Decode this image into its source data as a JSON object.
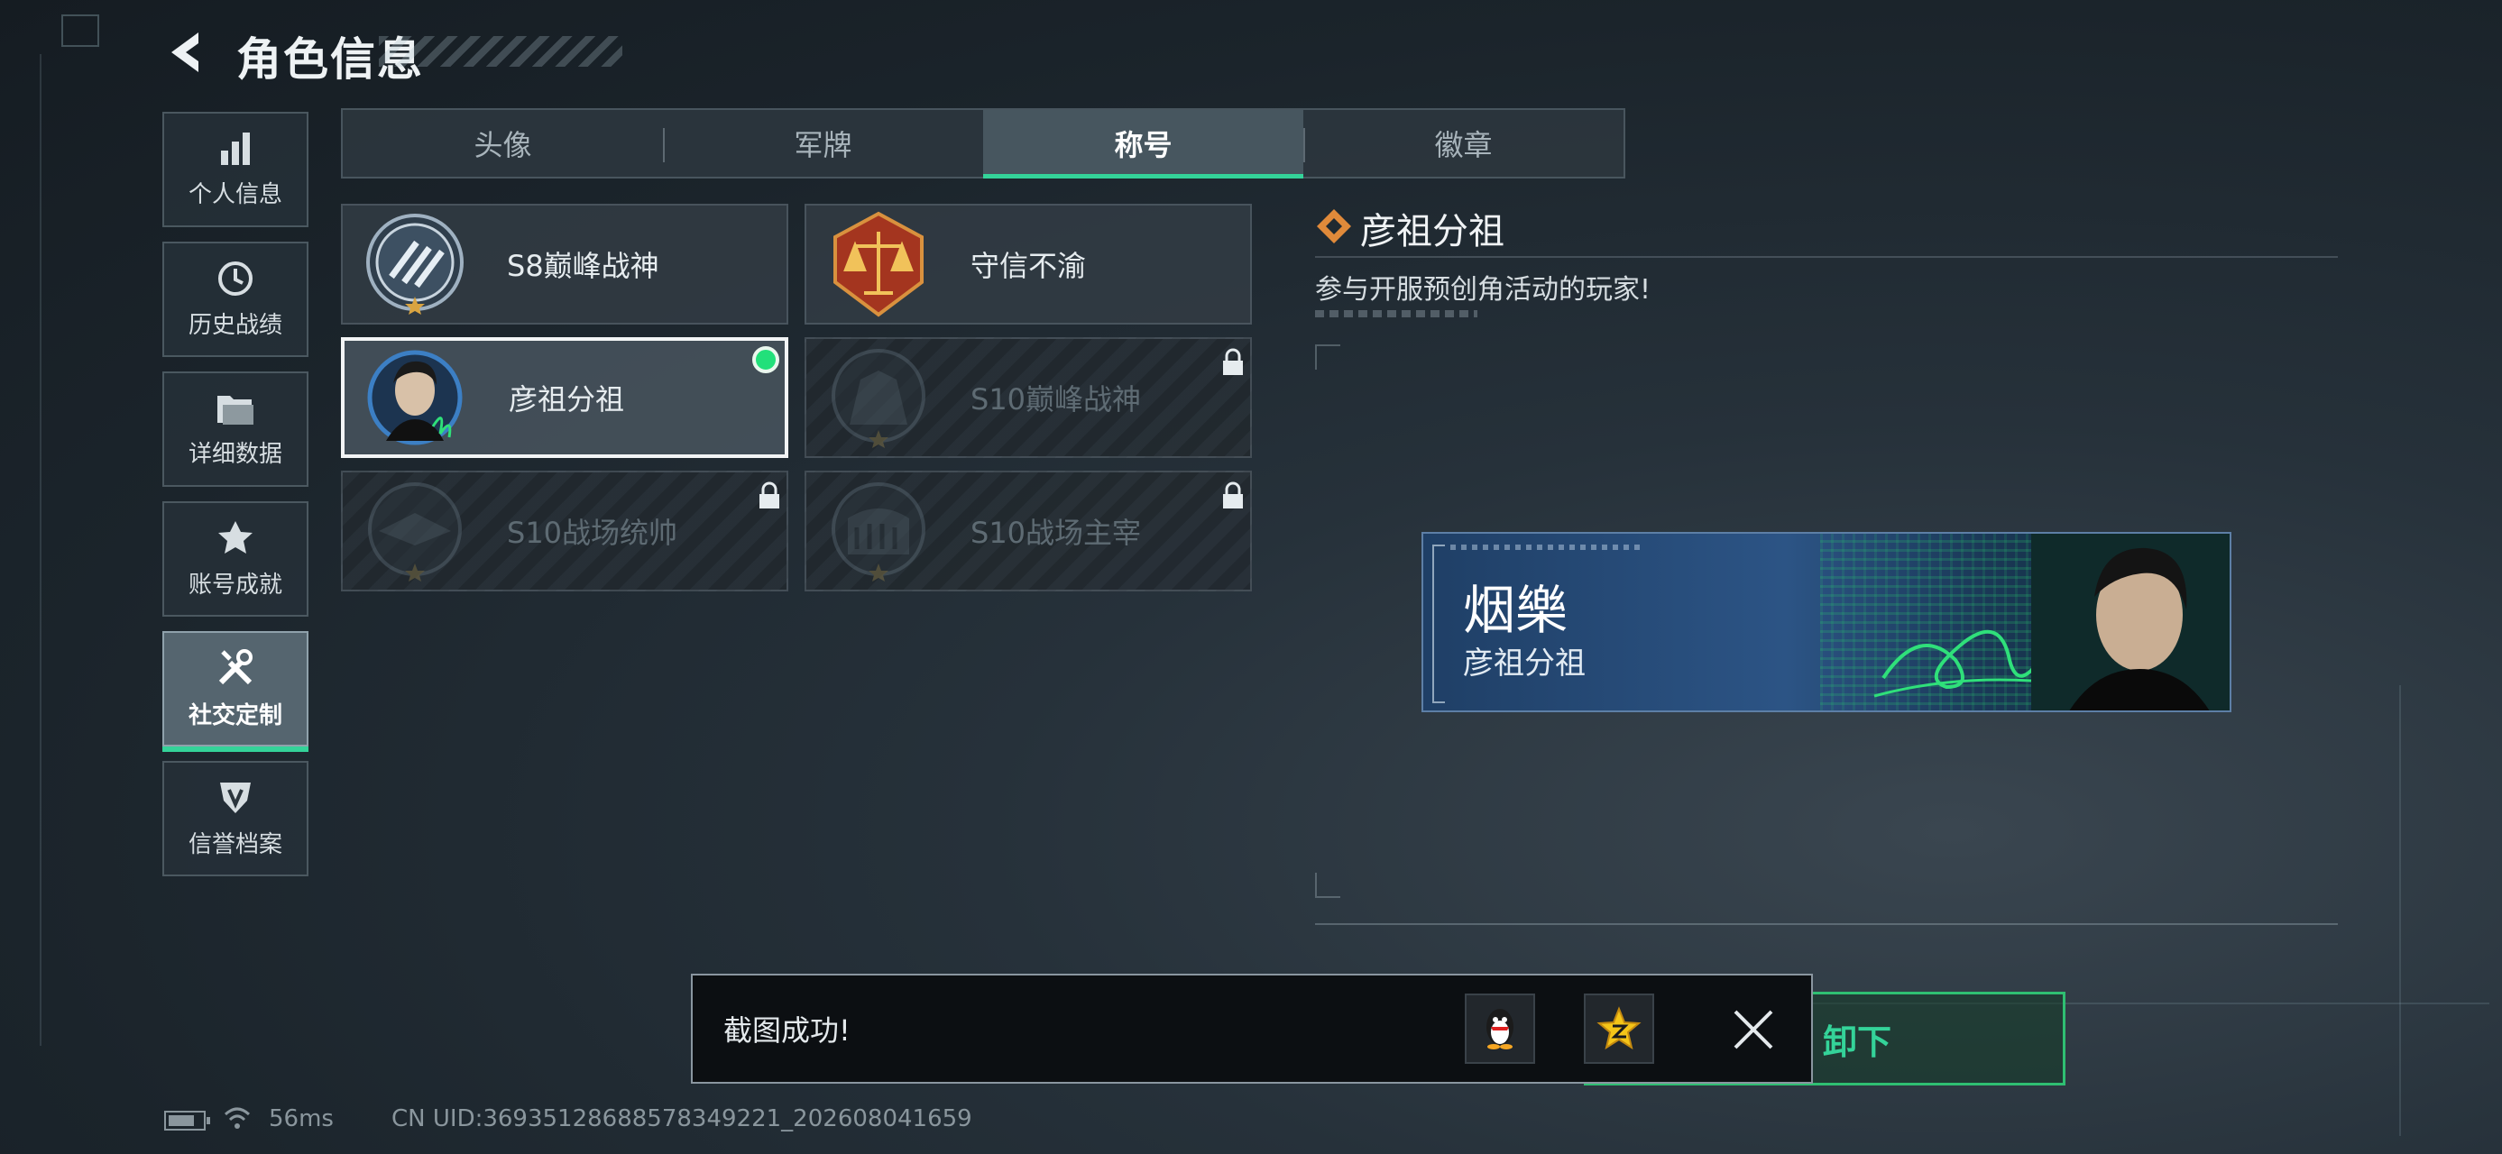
{
  "header": {
    "title": "角色信息"
  },
  "sidebar": {
    "items": [
      {
        "label": "个人信息",
        "icon": "bar-chart-icon"
      },
      {
        "label": "历史战绩",
        "icon": "history-clock-icon"
      },
      {
        "label": "详细数据",
        "icon": "folder-icon"
      },
      {
        "label": "账号成就",
        "icon": "achievement-icon"
      },
      {
        "label": "社交定制",
        "icon": "tools-icon",
        "active": true
      },
      {
        "label": "信誉档案",
        "icon": "shield-badge-icon"
      }
    ]
  },
  "tabs": [
    {
      "label": "头像"
    },
    {
      "label": "军牌"
    },
    {
      "label": "称号",
      "active": true
    },
    {
      "label": "徽章"
    }
  ],
  "titles": [
    {
      "name": "S8巅峰战神",
      "locked": false,
      "selected": false
    },
    {
      "name": "守信不渝",
      "locked": false,
      "selected": false
    },
    {
      "name": "彦祖分祖",
      "locked": false,
      "selected": true,
      "equipped": true
    },
    {
      "name": "S10巅峰战神",
      "locked": true,
      "selected": false
    },
    {
      "name": "S10战场统帅",
      "locked": true,
      "selected": false
    },
    {
      "name": "S10战场主宰",
      "locked": true,
      "selected": false
    }
  ],
  "detail": {
    "title": "彦祖分祖",
    "description": "参与开服预创角活动的玩家!",
    "banner": {
      "player_name": "烟樂",
      "title_text": "彦祖分祖"
    },
    "action_label": "卸下"
  },
  "toast": {
    "message": "截图成功!"
  },
  "status": {
    "ping": "56ms",
    "uid": "CN UID:369351286885783492​21_202608041659"
  },
  "colors": {
    "accent": "#34d399",
    "equipped_dot": "#22e07a"
  }
}
